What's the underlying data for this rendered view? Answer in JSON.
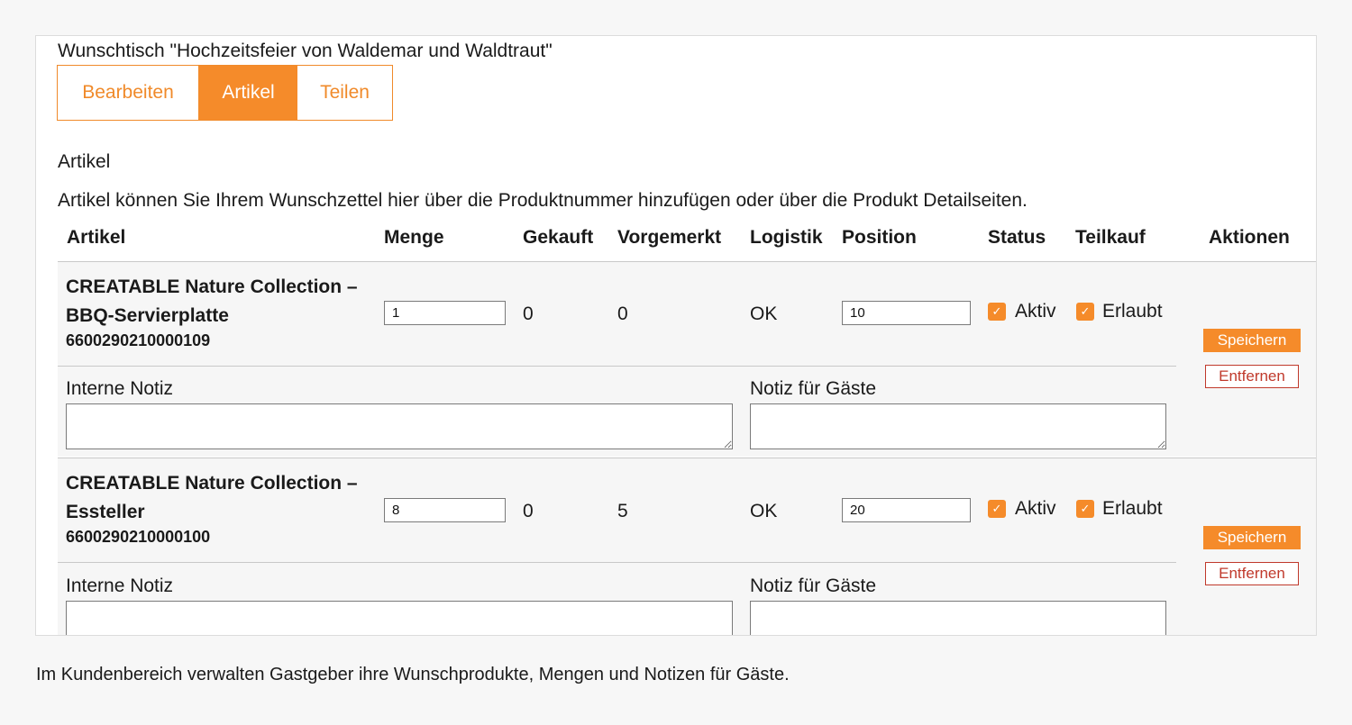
{
  "wishlist": {
    "title": "Wunschtisch \"Hochzeitsfeier von Waldemar und Waldtraut\"",
    "tabs": [
      {
        "label": "Bearbeiten"
      },
      {
        "label": "Artikel"
      },
      {
        "label": "Teilen"
      }
    ],
    "active_tab": "Artikel",
    "section_title": "Artikel",
    "description": "Artikel können Sie Ihrem Wunschzettel hier über die Produktnummer hinzufügen oder über die Produkt Detailseiten."
  },
  "table": {
    "headers": {
      "artikel": "Artikel",
      "menge": "Menge",
      "gekauft": "Gekauft",
      "vorgemerkt": "Vorgemerkt",
      "logistik": "Logistik",
      "position": "Position",
      "status": "Status",
      "teilkauf": "Teilkauf",
      "aktionen": "Aktionen"
    },
    "rows": [
      {
        "name": "CREATABLE Nature Collection – BBQ-Servierplatte",
        "number": "6600290210000109",
        "menge": "1",
        "gekauft": "0",
        "vorgemerkt": "0",
        "logistik": "OK",
        "position": "10",
        "status_label": "Aktiv",
        "teilkauf_label": "Erlaubt",
        "internal_note_label": "Interne Notiz",
        "guest_note_label": "Notiz für Gäste",
        "save_label": "Speichern",
        "remove_label": "Entfernen"
      },
      {
        "name": "CREATABLE Nature Collection – Essteller",
        "number": "6600290210000100",
        "menge": "8",
        "gekauft": "0",
        "vorgemerkt": "5",
        "logistik": "OK",
        "position": "20",
        "status_label": "Aktiv",
        "teilkauf_label": "Erlaubt",
        "internal_note_label": "Interne Notiz",
        "guest_note_label": "Notiz für Gäste",
        "save_label": "Speichern",
        "remove_label": "Entfernen"
      }
    ]
  },
  "caption": "Im Kundenbereich verwalten Gastgeber ihre Wunschprodukte, Mengen und Notizen für Gäste.",
  "colors": {
    "accent": "#f58b2a",
    "remove": "#c0392b"
  },
  "icons": {
    "checkbox": "check-icon"
  }
}
